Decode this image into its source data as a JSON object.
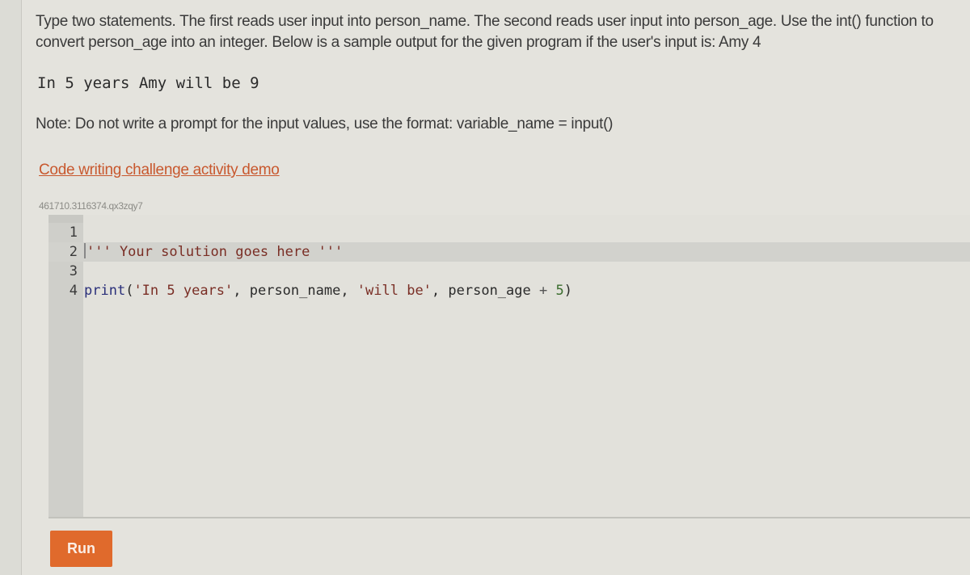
{
  "prompt": {
    "text": "Type two statements. The first reads user input into person_name. The second reads user input into person_age. Use the int() function to convert person_age into an integer. Below is a sample output for the given program if the user's input is: Amy 4"
  },
  "sample_output": "In 5 years Amy will be 9",
  "note": "Note: Do not write a prompt for the input values, use the format: variable_name = input()",
  "demo_link": "Code writing challenge activity demo",
  "activity_id": "461710.3116374.qx3zqy7",
  "editor": {
    "active_line": 2,
    "lines": [
      {
        "number": "1",
        "tokens": []
      },
      {
        "number": "2",
        "tokens": [
          {
            "type": "str",
            "text": "''' Your solution goes here '''"
          }
        ]
      },
      {
        "number": "3",
        "tokens": []
      },
      {
        "number": "4",
        "tokens": [
          {
            "type": "kw",
            "text": "print"
          },
          {
            "type": "id",
            "text": "("
          },
          {
            "type": "str",
            "text": "'In 5 years'"
          },
          {
            "type": "id",
            "text": ", person_name, "
          },
          {
            "type": "str",
            "text": "'will be'"
          },
          {
            "type": "id",
            "text": ", person_age "
          },
          {
            "type": "op",
            "text": "+"
          },
          {
            "type": "id",
            "text": " "
          },
          {
            "type": "num",
            "text": "5"
          },
          {
            "type": "id",
            "text": ")"
          }
        ]
      }
    ]
  },
  "run_button": {
    "label": "Run"
  },
  "colors": {
    "accent": "#e06a2c",
    "link": "#c8582e"
  }
}
